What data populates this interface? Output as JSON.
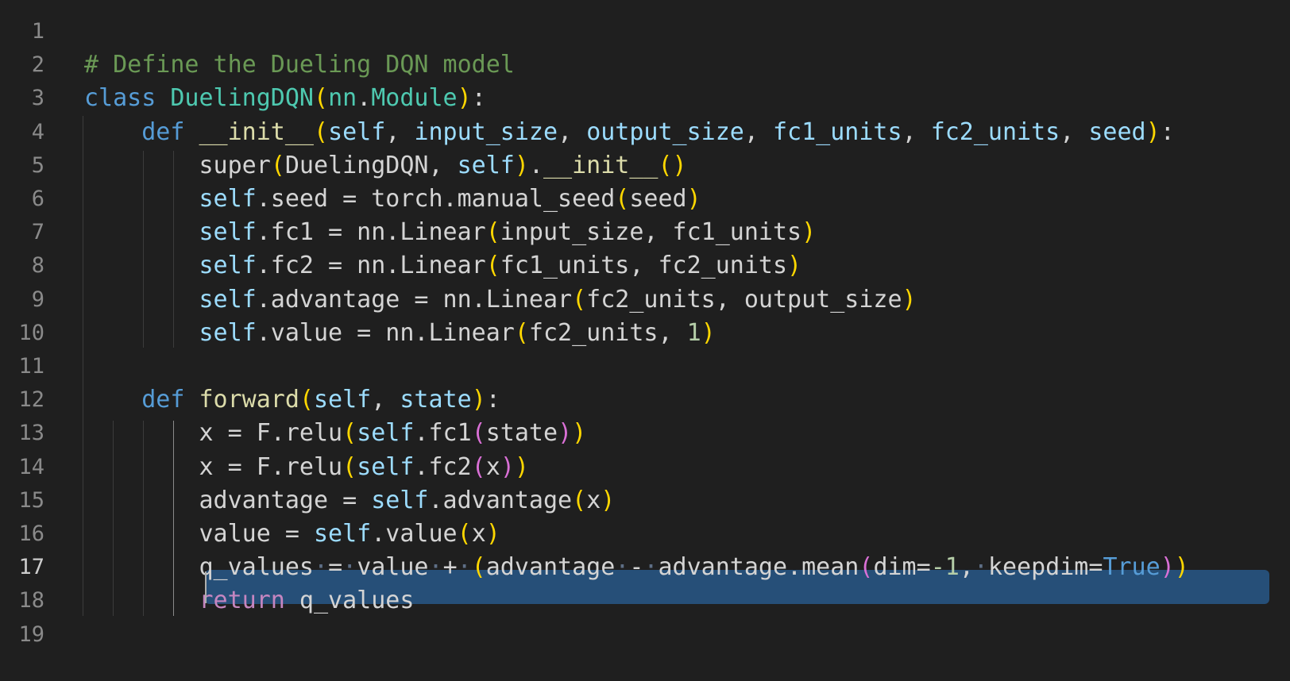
{
  "editor": {
    "active_line": 17,
    "selected_line": 17,
    "lines": [
      {
        "number": "1",
        "tokens": []
      },
      {
        "number": "2",
        "tokens": [
          {
            "t": "# Define the Dueling DQN model",
            "c": "comment"
          }
        ]
      },
      {
        "number": "3",
        "tokens": [
          {
            "t": "class",
            "c": "kw"
          },
          {
            "t": " ",
            "c": "plain"
          },
          {
            "t": "DuelingDQN",
            "c": "cls"
          },
          {
            "t": "(",
            "c": "br1"
          },
          {
            "t": "nn",
            "c": "cls"
          },
          {
            "t": ".",
            "c": "plain"
          },
          {
            "t": "Module",
            "c": "cls"
          },
          {
            "t": ")",
            "c": "br1"
          },
          {
            "t": ":",
            "c": "plain"
          }
        ]
      },
      {
        "number": "4",
        "tokens": [
          {
            "t": "    ",
            "c": "plain"
          },
          {
            "t": "def",
            "c": "kw"
          },
          {
            "t": " ",
            "c": "plain"
          },
          {
            "t": "__init__",
            "c": "fn"
          },
          {
            "t": "(",
            "c": "br1"
          },
          {
            "t": "self",
            "c": "param"
          },
          {
            "t": ", ",
            "c": "plain"
          },
          {
            "t": "input_size",
            "c": "param"
          },
          {
            "t": ", ",
            "c": "plain"
          },
          {
            "t": "output_size",
            "c": "param"
          },
          {
            "t": ", ",
            "c": "plain"
          },
          {
            "t": "fc1_units",
            "c": "param"
          },
          {
            "t": ", ",
            "c": "plain"
          },
          {
            "t": "fc2_units",
            "c": "param"
          },
          {
            "t": ", ",
            "c": "plain"
          },
          {
            "t": "seed",
            "c": "param"
          },
          {
            "t": ")",
            "c": "br1"
          },
          {
            "t": ":",
            "c": "plain"
          }
        ]
      },
      {
        "number": "5",
        "tokens": [
          {
            "t": "        ",
            "c": "plain"
          },
          {
            "t": "super",
            "c": "plain"
          },
          {
            "t": "(",
            "c": "br1"
          },
          {
            "t": "DuelingDQN",
            "c": "plain"
          },
          {
            "t": ", ",
            "c": "plain"
          },
          {
            "t": "self",
            "c": "self"
          },
          {
            "t": ")",
            "c": "br1"
          },
          {
            "t": ".",
            "c": "plain"
          },
          {
            "t": "__init__",
            "c": "fn"
          },
          {
            "t": "()",
            "c": "br1"
          }
        ]
      },
      {
        "number": "6",
        "tokens": [
          {
            "t": "        ",
            "c": "plain"
          },
          {
            "t": "self",
            "c": "self"
          },
          {
            "t": ".seed = torch.manual_seed",
            "c": "plain"
          },
          {
            "t": "(",
            "c": "br1"
          },
          {
            "t": "seed",
            "c": "plain"
          },
          {
            "t": ")",
            "c": "br1"
          }
        ]
      },
      {
        "number": "7",
        "tokens": [
          {
            "t": "        ",
            "c": "plain"
          },
          {
            "t": "self",
            "c": "self"
          },
          {
            "t": ".fc1 = nn.Linear",
            "c": "plain"
          },
          {
            "t": "(",
            "c": "br1"
          },
          {
            "t": "input_size, fc1_units",
            "c": "plain"
          },
          {
            "t": ")",
            "c": "br1"
          }
        ]
      },
      {
        "number": "8",
        "tokens": [
          {
            "t": "        ",
            "c": "plain"
          },
          {
            "t": "self",
            "c": "self"
          },
          {
            "t": ".fc2 = nn.Linear",
            "c": "plain"
          },
          {
            "t": "(",
            "c": "br1"
          },
          {
            "t": "fc1_units, fc2_units",
            "c": "plain"
          },
          {
            "t": ")",
            "c": "br1"
          }
        ]
      },
      {
        "number": "9",
        "tokens": [
          {
            "t": "        ",
            "c": "plain"
          },
          {
            "t": "self",
            "c": "self"
          },
          {
            "t": ".advantage = nn.Linear",
            "c": "plain"
          },
          {
            "t": "(",
            "c": "br1"
          },
          {
            "t": "fc2_units, output_size",
            "c": "plain"
          },
          {
            "t": ")",
            "c": "br1"
          }
        ]
      },
      {
        "number": "10",
        "tokens": [
          {
            "t": "        ",
            "c": "plain"
          },
          {
            "t": "self",
            "c": "self"
          },
          {
            "t": ".value = nn.Linear",
            "c": "plain"
          },
          {
            "t": "(",
            "c": "br1"
          },
          {
            "t": "fc2_units, ",
            "c": "plain"
          },
          {
            "t": "1",
            "c": "num"
          },
          {
            "t": ")",
            "c": "br1"
          }
        ]
      },
      {
        "number": "11",
        "tokens": []
      },
      {
        "number": "12",
        "tokens": [
          {
            "t": "    ",
            "c": "plain"
          },
          {
            "t": "def",
            "c": "kw"
          },
          {
            "t": " ",
            "c": "plain"
          },
          {
            "t": "forward",
            "c": "fn"
          },
          {
            "t": "(",
            "c": "br1"
          },
          {
            "t": "self",
            "c": "param"
          },
          {
            "t": ", ",
            "c": "plain"
          },
          {
            "t": "state",
            "c": "param"
          },
          {
            "t": ")",
            "c": "br1"
          },
          {
            "t": ":",
            "c": "plain"
          }
        ]
      },
      {
        "number": "13",
        "tokens": [
          {
            "t": "        ",
            "c": "plain"
          },
          {
            "t": "x = F.relu",
            "c": "plain"
          },
          {
            "t": "(",
            "c": "br1"
          },
          {
            "t": "self",
            "c": "self"
          },
          {
            "t": ".fc1",
            "c": "plain"
          },
          {
            "t": "(",
            "c": "br2"
          },
          {
            "t": "state",
            "c": "plain"
          },
          {
            "t": ")",
            "c": "br2"
          },
          {
            "t": ")",
            "c": "br1"
          }
        ]
      },
      {
        "number": "14",
        "tokens": [
          {
            "t": "        ",
            "c": "plain"
          },
          {
            "t": "x = F.relu",
            "c": "plain"
          },
          {
            "t": "(",
            "c": "br1"
          },
          {
            "t": "self",
            "c": "self"
          },
          {
            "t": ".fc2",
            "c": "plain"
          },
          {
            "t": "(",
            "c": "br2"
          },
          {
            "t": "x",
            "c": "plain"
          },
          {
            "t": ")",
            "c": "br2"
          },
          {
            "t": ")",
            "c": "br1"
          }
        ]
      },
      {
        "number": "15",
        "tokens": [
          {
            "t": "        ",
            "c": "plain"
          },
          {
            "t": "advantage = ",
            "c": "plain"
          },
          {
            "t": "self",
            "c": "self"
          },
          {
            "t": ".advantage",
            "c": "plain"
          },
          {
            "t": "(",
            "c": "br1"
          },
          {
            "t": "x",
            "c": "plain"
          },
          {
            "t": ")",
            "c": "br1"
          }
        ]
      },
      {
        "number": "16",
        "tokens": [
          {
            "t": "        ",
            "c": "plain"
          },
          {
            "t": "value = ",
            "c": "plain"
          },
          {
            "t": "self",
            "c": "self"
          },
          {
            "t": ".value",
            "c": "plain"
          },
          {
            "t": "(",
            "c": "br1"
          },
          {
            "t": "x",
            "c": "plain"
          },
          {
            "t": ")",
            "c": "br1"
          }
        ]
      },
      {
        "number": "17",
        "tokens": [
          {
            "t": "        ",
            "c": "plain"
          },
          {
            "t": "q_values",
            "c": "plain"
          },
          {
            "t": "·",
            "c": "ws"
          },
          {
            "t": "=",
            "c": "plain"
          },
          {
            "t": "·",
            "c": "ws"
          },
          {
            "t": "value",
            "c": "plain"
          },
          {
            "t": "·",
            "c": "ws"
          },
          {
            "t": "+",
            "c": "plain"
          },
          {
            "t": "·",
            "c": "ws"
          },
          {
            "t": "(",
            "c": "br1"
          },
          {
            "t": "advantage",
            "c": "plain"
          },
          {
            "t": "·",
            "c": "ws"
          },
          {
            "t": "-",
            "c": "plain"
          },
          {
            "t": "·",
            "c": "ws"
          },
          {
            "t": "advantage.mean",
            "c": "plain"
          },
          {
            "t": "(",
            "c": "br2"
          },
          {
            "t": "dim=",
            "c": "plain"
          },
          {
            "t": "-1",
            "c": "num"
          },
          {
            "t": ",",
            "c": "plain"
          },
          {
            "t": "·",
            "c": "ws"
          },
          {
            "t": "keepdim=",
            "c": "plain"
          },
          {
            "t": "True",
            "c": "kw"
          },
          {
            "t": ")",
            "c": "br2"
          },
          {
            "t": ")",
            "c": "br1"
          }
        ]
      },
      {
        "number": "18",
        "tokens": [
          {
            "t": "        ",
            "c": "plain"
          },
          {
            "t": "return",
            "c": "ctrl"
          },
          {
            "t": " q_values",
            "c": "plain"
          }
        ]
      },
      {
        "number": "19",
        "tokens": []
      }
    ]
  }
}
